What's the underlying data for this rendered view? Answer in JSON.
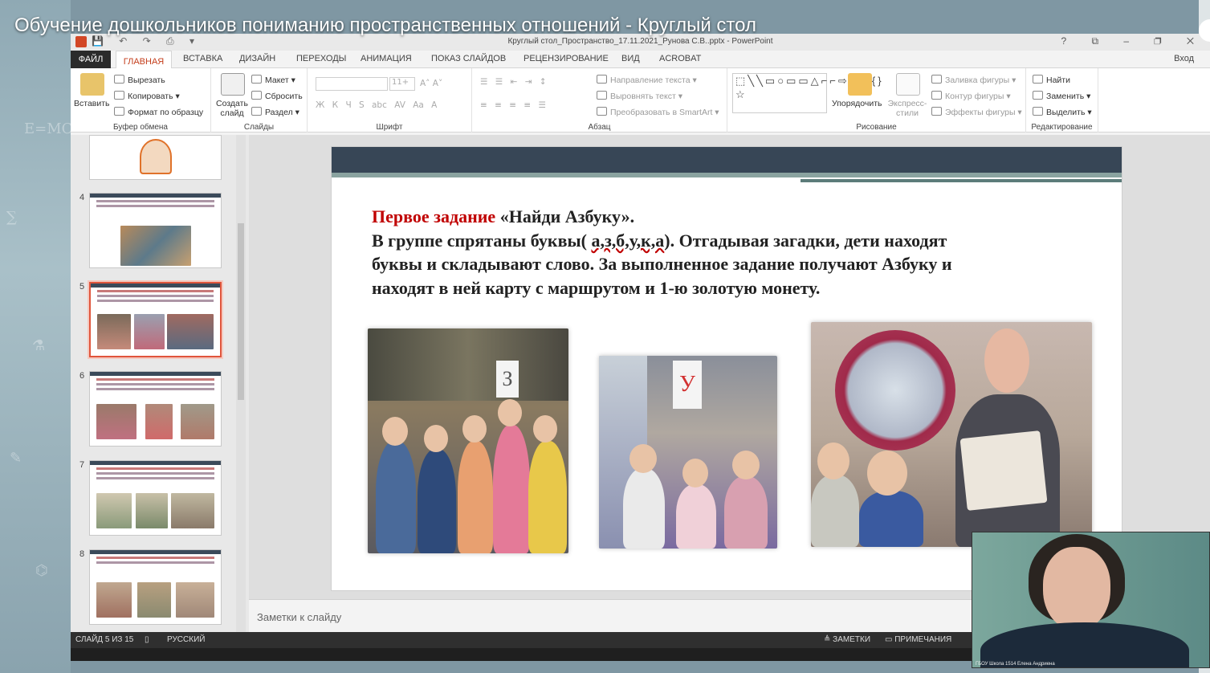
{
  "video": {
    "title": "Обучение дошкольников пониманию пространственных отношений - Круглый стол"
  },
  "window": {
    "document_title": "Круглый стол_Пространство_17.11.2021_Рунова С.В..pptx - PowerPoint",
    "qat_icons": "💾 ↶ ↷ ⎙ ▾",
    "window_buttons": "? ⧉ – ❐ ✕",
    "sign_in": "Вход"
  },
  "ribbon_tabs": [
    {
      "label": "ФАЙЛ"
    },
    {
      "label": "ГЛАВНАЯ"
    },
    {
      "label": "ВСТАВКА"
    },
    {
      "label": "ДИЗАЙН"
    },
    {
      "label": "ПЕРЕХОДЫ"
    },
    {
      "label": "АНИМАЦИЯ"
    },
    {
      "label": "ПОКАЗ СЛАЙДОВ"
    },
    {
      "label": "РЕЦЕНЗИРОВАНИЕ"
    },
    {
      "label": "ВИД"
    },
    {
      "label": "ACROBAT"
    }
  ],
  "ribbon": {
    "clipboard": {
      "label": "Буфер обмена",
      "paste": "Вставить",
      "cut": "Вырезать",
      "copy": "Копировать",
      "format_painter": "Формат по образцу"
    },
    "slides": {
      "label": "Слайды",
      "new_slide": "Создать слайд",
      "layout": "Макет",
      "reset": "Сбросить",
      "section": "Раздел"
    },
    "font": {
      "label": "Шрифт",
      "size": "11+",
      "grow_shrink": "A˄ A˅",
      "styles": "Ж К Ч S abc AV Aa A"
    },
    "paragraph": {
      "label": "Абзац",
      "text_direction": "Направление текста",
      "align_text": "Выровнять текст",
      "smartart": "Преобразовать в SmartArt",
      "list_icons": "☰ ☰ ⇤ ⇥ ↕",
      "align_icons": "≡ ≡ ≡ ≡ ☰"
    },
    "drawing": {
      "label": "Рисование",
      "shapes": "⬚╲╲▭○▭▭△⌐⌐⇨⇩⬠{}☆",
      "arrange": "Упорядочить",
      "quick_styles": "Экспресс-стили",
      "shape_fill": "Заливка фигуры",
      "shape_outline": "Контур фигуры",
      "shape_effects": "Эффекты фигуры"
    },
    "editing": {
      "label": "Редактирование",
      "find": "Найти",
      "replace": "Заменить",
      "select": "Выделить"
    }
  },
  "thumbnails": [
    {
      "num": "",
      "selected": false,
      "kind": "logo"
    },
    {
      "num": "4",
      "selected": false,
      "kind": "one-photo"
    },
    {
      "num": "5",
      "selected": true,
      "kind": "three-photos"
    },
    {
      "num": "6",
      "selected": false,
      "kind": "three-photos"
    },
    {
      "num": "7",
      "selected": false,
      "kind": "three-photos"
    },
    {
      "num": "8",
      "selected": false,
      "kind": "three-photos"
    }
  ],
  "slide": {
    "heading_red": "Первое задание",
    "heading_rest": " «Найди Азбуку».",
    "line2_a": "В группе спрятаны буквы( ",
    "line2_letters": "а,з,б,у,к,а",
    "line2_b": "). Отгадывая загадки, дети находят",
    "line3": "буквы и складывают слово. За выполненное задание получают Азбуку и",
    "line4": "находят в ней карту с маршрутом и 1-ю золотую монету.",
    "photo1_sign": "З",
    "photo2_sign": "У"
  },
  "notes_placeholder": "Заметки к слайду",
  "statusbar": {
    "slide_info": "СЛАЙД 5 ИЗ 15",
    "language": "РУССКИЙ",
    "notes": "ЗАМЕТКИ",
    "comments": "ПРИМЕЧАНИЯ"
  },
  "webcam": {
    "caption": "ГБОУ Школа 1514 Елена Андриена"
  },
  "colors": {
    "accent": "#c43e1c",
    "slide_bar": "#374656",
    "heading_red": "#c00000"
  }
}
